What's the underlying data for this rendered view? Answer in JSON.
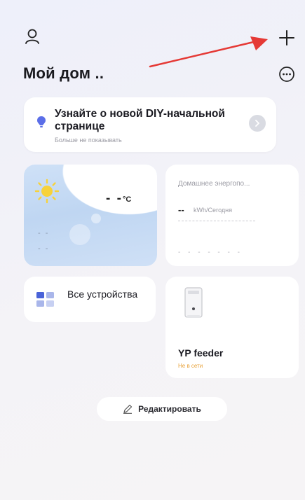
{
  "header": {
    "title": "Мой дом ..",
    "profile_icon": "profile-icon",
    "add_icon": "plus-icon",
    "more_icon": "more-circle-icon"
  },
  "banner": {
    "title": "Узнайте о новой DIY-начальной странице",
    "subtitle": "Больше не показывать",
    "icon": "lightbulb-icon",
    "action_icon": "chevron-right-icon",
    "accent": "#5b6ee8"
  },
  "weather": {
    "temperature": "- -",
    "unit": "°C",
    "line1": "- -",
    "line2": "- -",
    "icon": "sun-icon",
    "sun_color": "#f7d23a"
  },
  "energy": {
    "title": "Домашнее энергопо...",
    "value": "--",
    "unit": "kWh/Сегодня",
    "placeholder": "- - - - - - -"
  },
  "all_devices": {
    "label": "Все устройства",
    "icon": "device-grid-icon"
  },
  "device": {
    "name": "YP feeder",
    "status": "Не в сети",
    "status_color": "#e8a23a",
    "icon": "pet-feeder-icon"
  },
  "edit_button": {
    "label": "Редактировать",
    "icon": "pencil-icon"
  },
  "annotation": {
    "arrow_color": "#e53935"
  }
}
